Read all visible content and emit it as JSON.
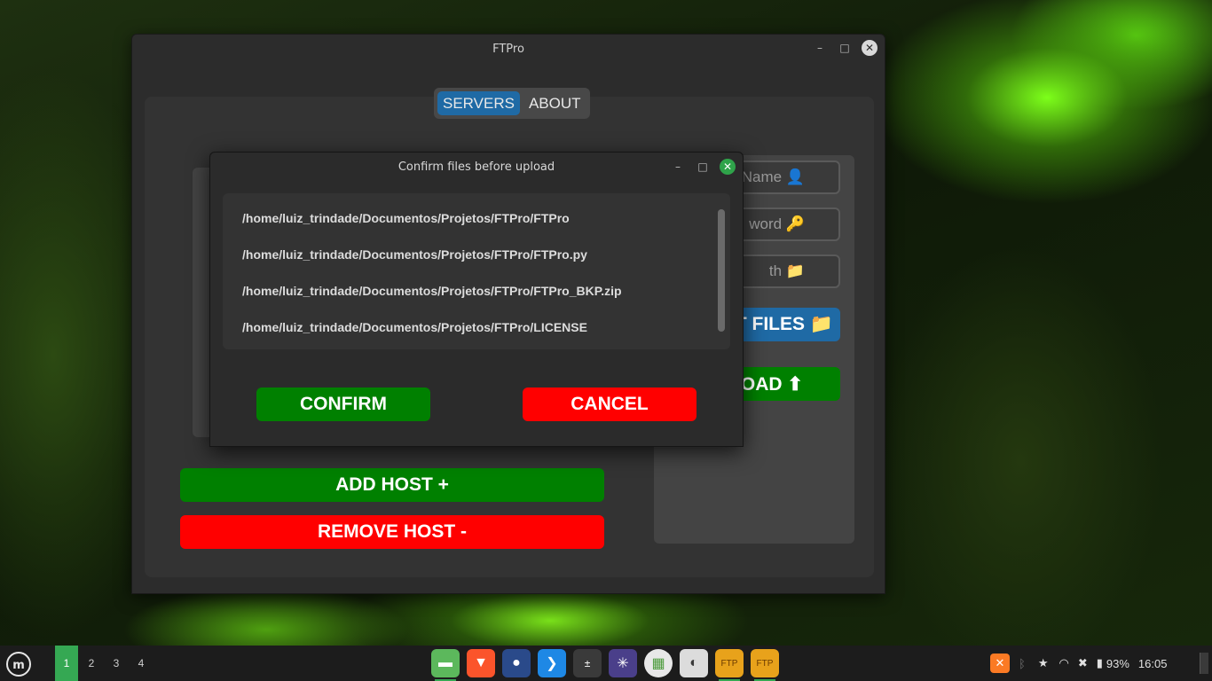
{
  "window": {
    "title": "FTPro",
    "min": "–",
    "max": "□",
    "close": "✕"
  },
  "tabs": [
    {
      "label": "SERVERS"
    },
    {
      "label": "ABOUT"
    }
  ],
  "side": {
    "name_placeholder": "Name 👤",
    "password_placeholder": "word 🔑",
    "path_placeholder": "th 📁",
    "select_files": "T FILES 📁",
    "upload": "OAD ⬆"
  },
  "actions": {
    "add_host": "ADD HOST +",
    "remove_host": "REMOVE HOST -"
  },
  "dialog": {
    "title": "Confirm files before upload",
    "min": "–",
    "max": "□",
    "close": "✕",
    "files": [
      "/home/luiz_trindade/Documentos/Projetos/FTPro/FTPro",
      "/home/luiz_trindade/Documentos/Projetos/FTPro/FTPro.py",
      "/home/luiz_trindade/Documentos/Projetos/FTPro/FTPro_BKP.zip",
      "/home/luiz_trindade/Documentos/Projetos/FTPro/LICENSE"
    ],
    "confirm": "CONFIRM",
    "cancel": "CANCEL"
  },
  "taskbar": {
    "workspaces": [
      "1",
      "2",
      "3",
      "4"
    ],
    "apps": [
      "files-icon",
      "brave-icon",
      "gimp-icon",
      "vscode-icon",
      "calculator-icon",
      "network-icon",
      "grid-app-icon",
      "settings-icon",
      "ftpro-icon",
      "ftpro-icon"
    ],
    "battery": "93%",
    "clock": "16:05"
  },
  "colors": {
    "accent_blue": "#1f6aa5",
    "green": "#008000",
    "red": "#ff0000",
    "mint": "#35a853"
  }
}
